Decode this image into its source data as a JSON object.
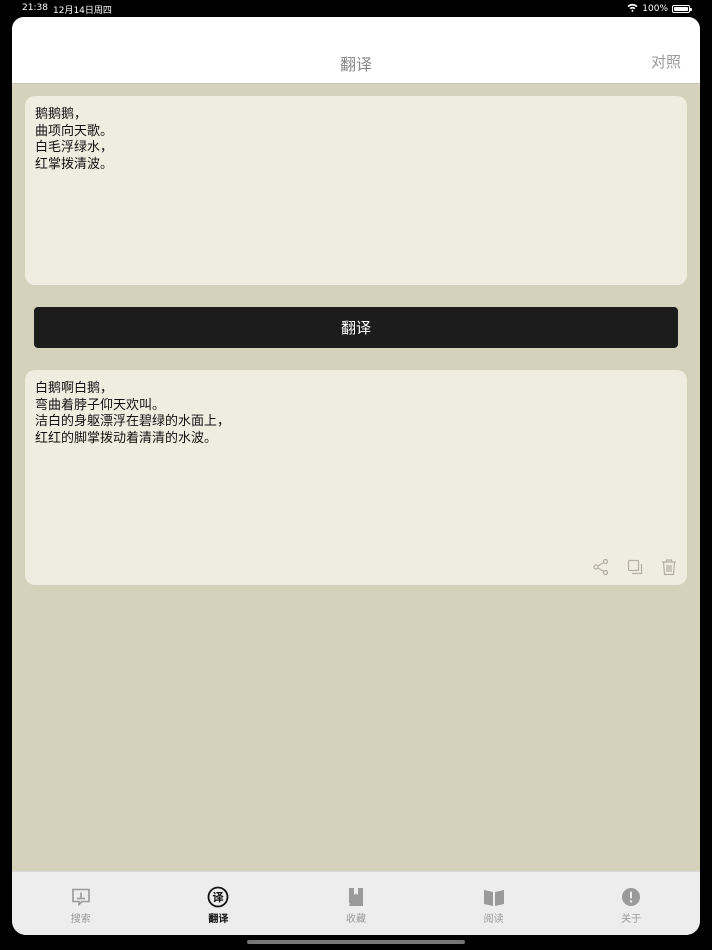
{
  "status_bar": {
    "time": "21:38",
    "date": "12月14日周四",
    "battery": "100%",
    "battery_level": 1.0
  },
  "nav": {
    "title": "翻译",
    "compare_label": "对照"
  },
  "input": {
    "text": "鹅鹅鹅，\n曲项向天歌。\n白毛浮绿水，\n红掌拨清波。"
  },
  "translate_button_label": "翻译",
  "output": {
    "text": "白鹅啊白鹅，\n弯曲着脖子仰天欢叫。\n洁白的身躯漂浮在碧绿的水面上，\n红红的脚掌拨动着清清的水波。",
    "actions": [
      {
        "icon": "share-icon"
      },
      {
        "icon": "copy-icon"
      },
      {
        "icon": "trash-icon"
      }
    ]
  },
  "tabs": [
    {
      "label": "搜索",
      "icon": "search-message-icon",
      "active": false
    },
    {
      "label": "翻译",
      "icon": "translate-icon",
      "active": true
    },
    {
      "label": "收藏",
      "icon": "bookmark-book-icon",
      "active": false
    },
    {
      "label": "阅读",
      "icon": "open-book-icon",
      "active": false
    },
    {
      "label": "关于",
      "icon": "info-exclamation-icon",
      "active": false
    }
  ],
  "colors": {
    "background": "#d5d2bb",
    "card": "#efece0",
    "button": "#1c1c1c",
    "tab_bar": "#ededed"
  }
}
